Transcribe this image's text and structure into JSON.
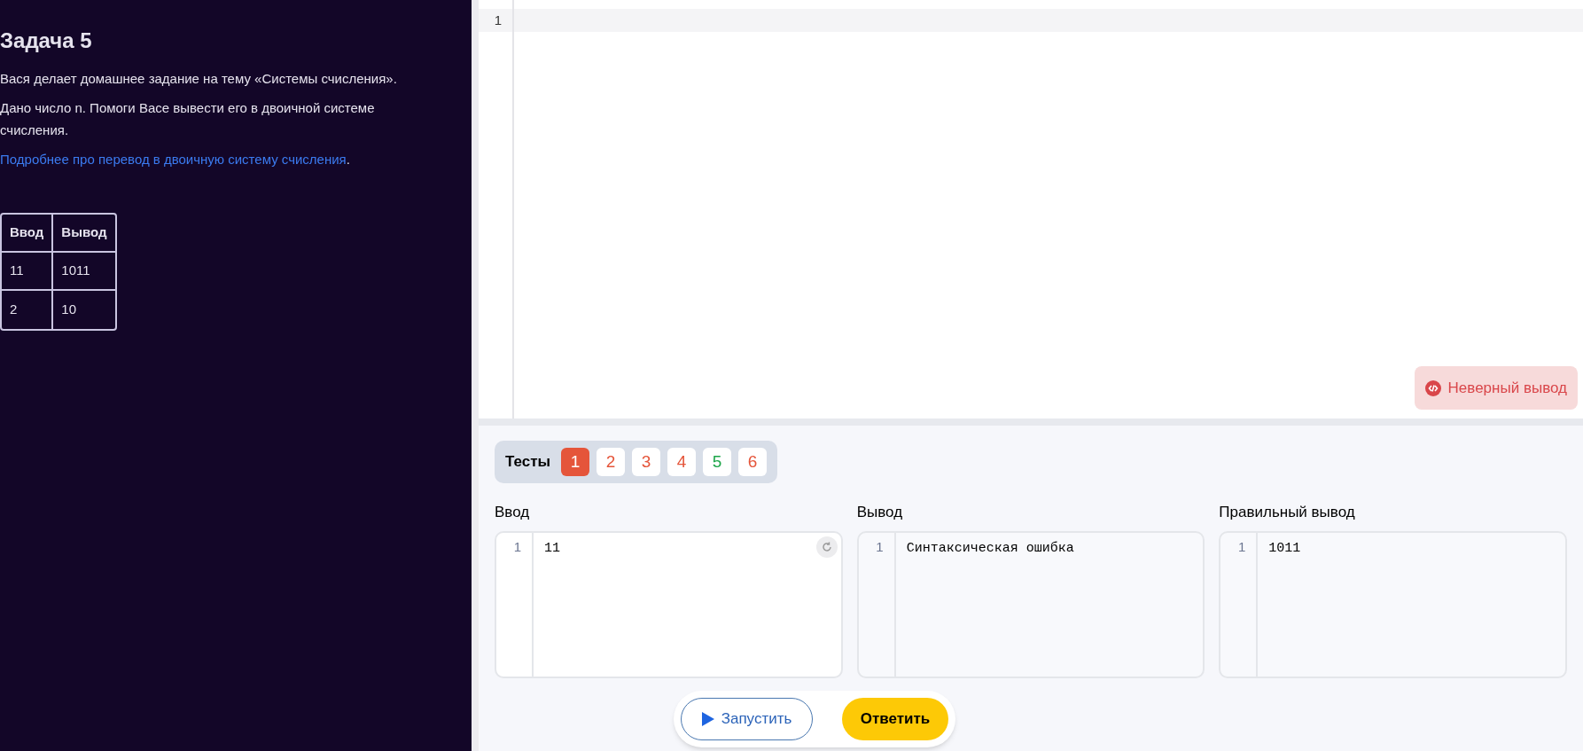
{
  "task": {
    "title": "Задача 5",
    "paragraphs": [
      "Вася делает домашнее задание на тему «Системы счисления».",
      "Дано число n. Помоги Васе вывести его в двоичной системе счисления."
    ],
    "link": {
      "text": "Подробнее про перевод в двоичную систему счисления",
      "after": "."
    },
    "examples": {
      "columns": [
        "Ввод",
        "Вывод"
      ],
      "rows": [
        [
          "11",
          "1011"
        ],
        [
          "2",
          "10"
        ]
      ]
    }
  },
  "editor": {
    "lines": [
      {
        "number": "1"
      }
    ],
    "verdict": "Неверный вывод"
  },
  "tests": {
    "label": "Тесты",
    "items": [
      {
        "label": "1",
        "color": "#e5553a",
        "selected": true
      },
      {
        "label": "2",
        "color": "#e5553a",
        "selected": false
      },
      {
        "label": "3",
        "color": "#e5553a",
        "selected": false
      },
      {
        "label": "4",
        "color": "#e5553a",
        "selected": false
      },
      {
        "label": "5",
        "color": "#1ea64a",
        "selected": false
      },
      {
        "label": "6",
        "color": "#e5553a",
        "selected": false
      }
    ]
  },
  "panels": [
    {
      "kind": "input",
      "title": "Ввод",
      "line_number": "1",
      "text": "11"
    },
    {
      "kind": "output",
      "title": "Вывод",
      "line_number": "1",
      "text": "Синтаксическая ошибка"
    },
    {
      "kind": "output",
      "title": "Правильный вывод",
      "line_number": "1",
      "text": "1011"
    }
  ],
  "buttons": {
    "run": "Запустить",
    "submit": "Ответить"
  }
}
